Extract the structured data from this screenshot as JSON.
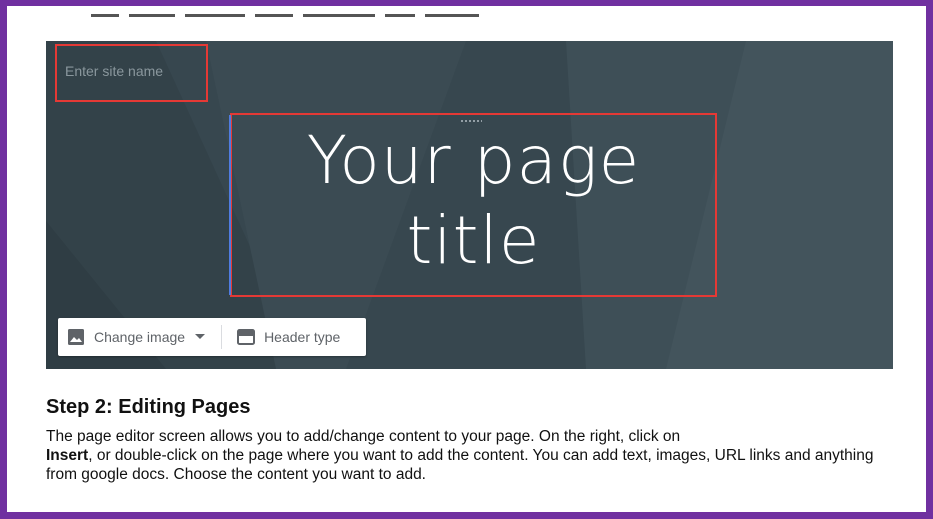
{
  "banner": {
    "site_name_placeholder": "Enter site name",
    "page_title_line1": "Your page",
    "page_title_line2": "title",
    "background_color": "#37474f",
    "highlight_color": "#e53935"
  },
  "toolbar": {
    "change_image_label": "Change image",
    "header_type_label": "Header type",
    "icons": [
      "image-icon",
      "caret-down-icon",
      "header-type-icon"
    ]
  },
  "step": {
    "heading": "Step 2: Editing Pages",
    "body_part1": "The page editor screen allows you to add/change content to your page. On the right, click on",
    "body_bold": "Insert",
    "body_part2": ", or double-click on the page where you want to add the content. You can add text, images, URL links and anything from google docs. Choose the content you want to add."
  },
  "frame_color": "#7030a0"
}
